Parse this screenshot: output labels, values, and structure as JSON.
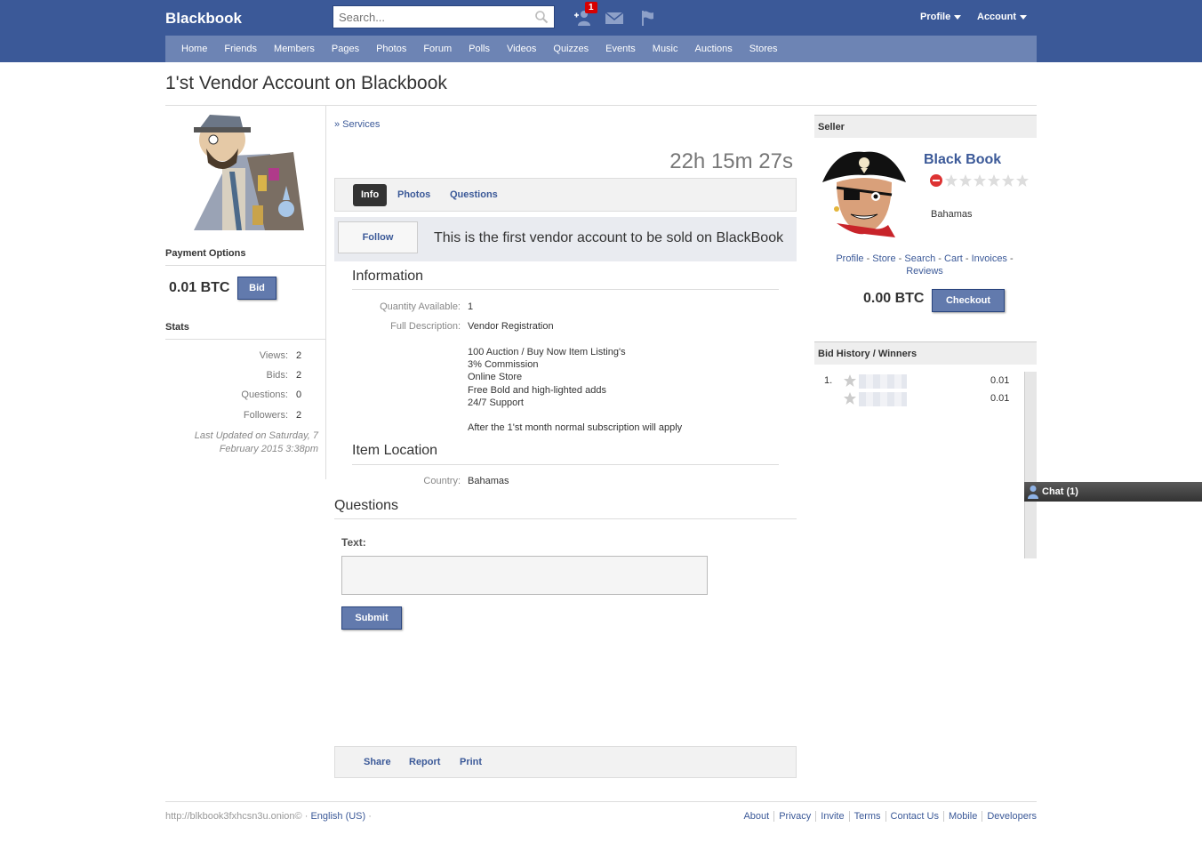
{
  "header": {
    "brand": "Blackbook",
    "search_placeholder": "Search...",
    "notification_count": "1",
    "profile_menu": "Profile",
    "account_menu": "Account"
  },
  "nav": [
    "Home",
    "Friends",
    "Members",
    "Pages",
    "Photos",
    "Forum",
    "Polls",
    "Videos",
    "Quizzes",
    "Events",
    "Music",
    "Auctions",
    "Stores"
  ],
  "page": {
    "title": "1'st Vendor Account on Blackbook"
  },
  "left": {
    "payment_heading": "Payment Options",
    "price": "0.01 BTC",
    "bid_label": "Bid",
    "stats_heading": "Stats",
    "stats": [
      {
        "label": "Views:",
        "value": "2"
      },
      {
        "label": "Bids:",
        "value": "2"
      },
      {
        "label": "Questions:",
        "value": "0"
      },
      {
        "label": "Followers:",
        "value": "2"
      }
    ],
    "last_updated": "Last Updated on Saturday, 7 February 2015 3:38pm"
  },
  "center": {
    "breadcrumb": "» Services",
    "countdown": "22h 15m 27s",
    "tabs": [
      "Info",
      "Photos",
      "Questions"
    ],
    "follow_label": "Follow",
    "headline": "This is the first vendor account to be sold on BlackBook",
    "information_heading": "Information",
    "quantity_label": "Quantity Available:",
    "quantity_value": "1",
    "description_label": "Full Description:",
    "description_first": "Vendor Registration",
    "description_lines": [
      "100 Auction / Buy Now Item Listing's",
      "3% Commission",
      "Online Store",
      "Free Bold and high-lighted adds",
      "24/7 Support",
      "",
      "After the 1'st month normal subscription will apply"
    ],
    "location_heading": "Item Location",
    "country_label": "Country:",
    "country_value": "Bahamas",
    "questions_heading": "Questions",
    "text_label": "Text:",
    "submit_label": "Submit",
    "share_label": "Share",
    "report_label": "Report",
    "print_label": "Print"
  },
  "seller": {
    "heading": "Seller",
    "name": "Black Book",
    "rating_stars": 0,
    "country": "Bahamas",
    "links": [
      "Profile",
      "Store",
      "Search",
      "Cart",
      "Invoices",
      "Reviews"
    ],
    "cart_total": "0.00 BTC",
    "checkout_label": "Checkout"
  },
  "bid_history": {
    "heading": "Bid History / Winners",
    "rows": [
      {
        "rank": "1.",
        "amount": "0.01"
      },
      {
        "rank": "",
        "amount": "0.01"
      }
    ]
  },
  "chat": {
    "label": "Chat (1)"
  },
  "footer": {
    "site": "http://blkbook3fxhcsn3u.onion©",
    "language": "English (US)",
    "links": [
      "About",
      "Privacy",
      "Invite",
      "Terms",
      "Contact Us",
      "Mobile",
      "Developers"
    ]
  },
  "colors": {
    "brand_blue": "#3b5998",
    "nav_blue": "#6d84b4",
    "button_blue": "#627aad",
    "badge_red": "#d60000"
  }
}
